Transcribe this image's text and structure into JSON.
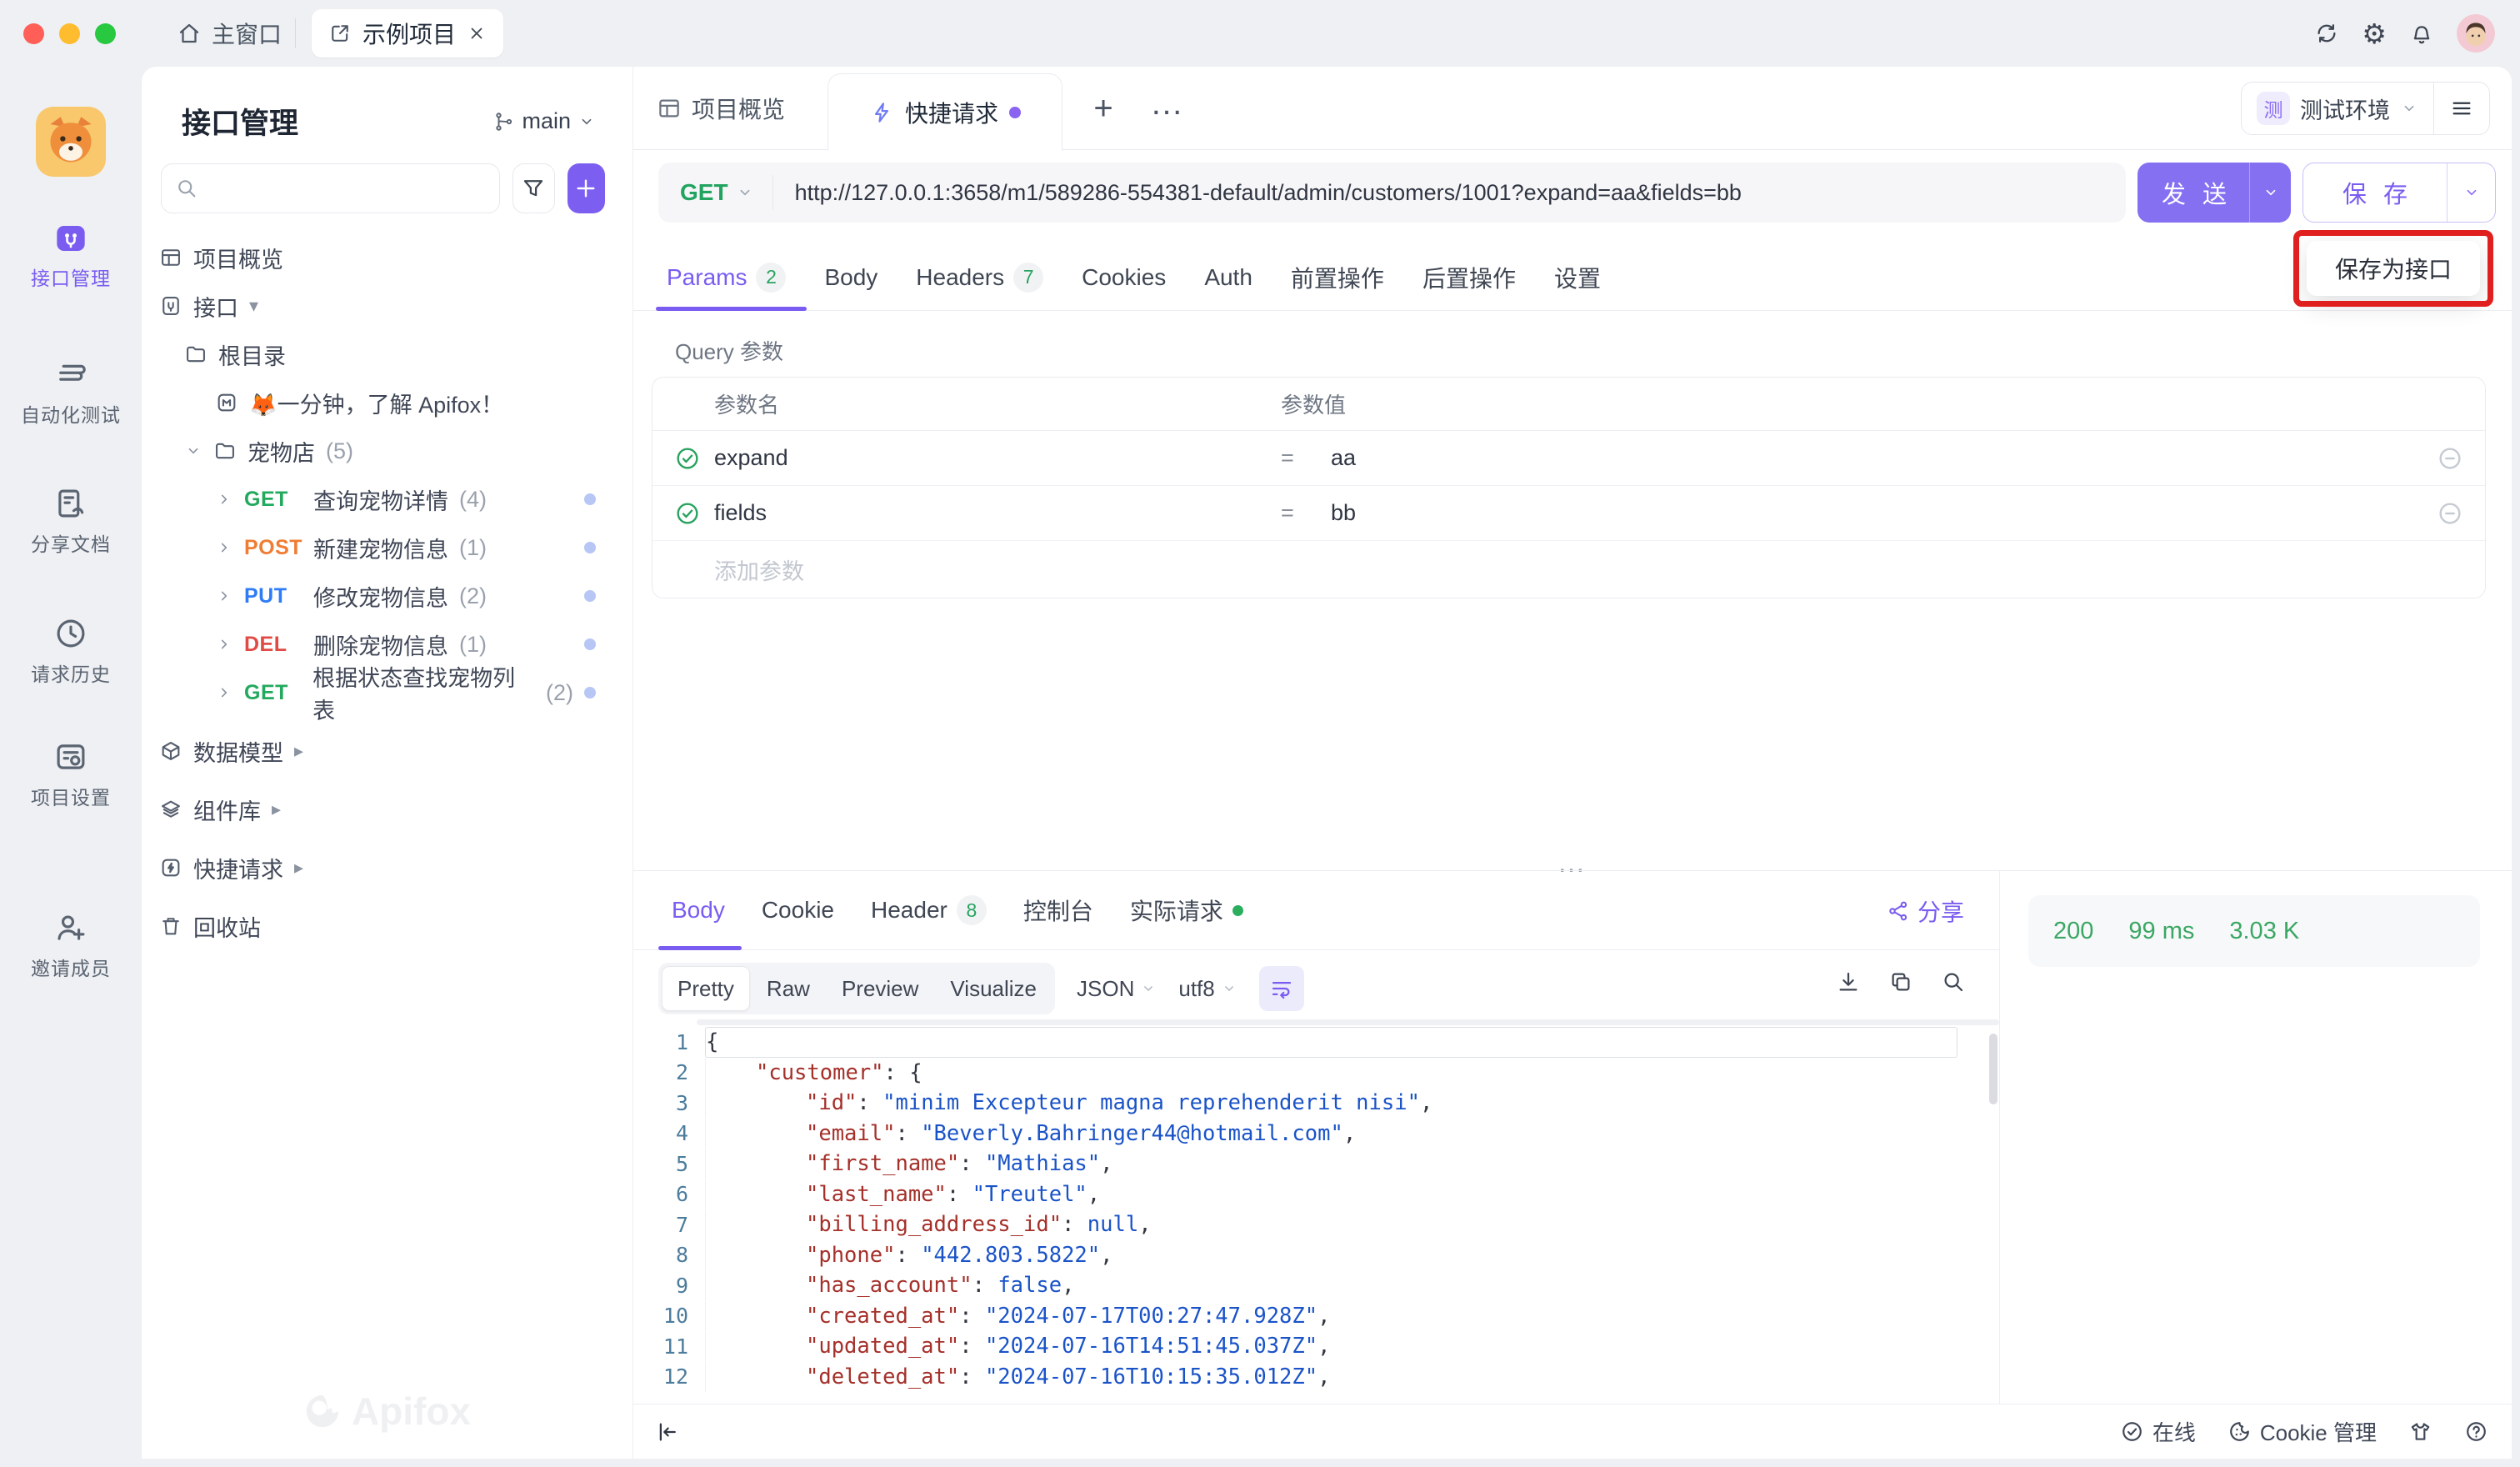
{
  "icons": {
    "gear": "⚙",
    "plus": "+",
    "ellipsis": "…",
    "more_tabs": "…",
    "caret_down": "▾",
    "caret_right": "▸"
  },
  "titlebar": {
    "home_tab": "主窗口",
    "project_tab": "示例项目"
  },
  "rail": {
    "items": [
      {
        "label": "接口管理"
      },
      {
        "label": "自动化测试"
      },
      {
        "label": "分享文档"
      },
      {
        "label": "请求历史"
      },
      {
        "label": "项目设置"
      },
      {
        "label": "邀请成员"
      }
    ]
  },
  "sidebar": {
    "title": "接口管理",
    "branch": "main",
    "tree": {
      "overview": "项目概览",
      "api_root": "接口",
      "root_folder": "根目录",
      "doc": "🦊一分钟，了解 Apifox！",
      "petstore": "宠物店",
      "petstore_count": "(5)",
      "items": [
        {
          "method": "GET",
          "label": "查询宠物详情",
          "count": "(4)"
        },
        {
          "method": "POST",
          "label": "新建宠物信息",
          "count": "(1)"
        },
        {
          "method": "PUT",
          "label": "修改宠物信息",
          "count": "(2)"
        },
        {
          "method": "DEL",
          "label": "删除宠物信息",
          "count": "(1)"
        },
        {
          "method": "GET",
          "label": "根据状态查找宠物列表",
          "count": "(2)"
        }
      ],
      "models": "数据模型",
      "components": "组件库",
      "quick": "快捷请求",
      "trash": "回收站"
    },
    "watermark": "Apifox"
  },
  "tabs": {
    "overview": "项目概览",
    "quick": "快捷请求"
  },
  "env": {
    "badge": "测",
    "label": "测试环境"
  },
  "request": {
    "method": "GET",
    "url": "http://127.0.0.1:3658/m1/589286-554381-default/admin/customers/1001?expand=aa&fields=bb",
    "send": "发 送",
    "save": "保 存",
    "save_menu": "保存为接口"
  },
  "subtabs": {
    "params": "Params",
    "params_badge": "2",
    "body": "Body",
    "headers": "Headers",
    "headers_badge": "7",
    "cookies": "Cookies",
    "auth": "Auth",
    "pre": "前置操作",
    "post": "后置操作",
    "settings": "设置"
  },
  "query": {
    "section": "Query 参数",
    "col_name": "参数名",
    "col_value": "参数值",
    "rows": [
      {
        "name": "expand",
        "eq": "=",
        "value": "aa"
      },
      {
        "name": "fields",
        "eq": "=",
        "value": "bb"
      }
    ],
    "add": "添加参数"
  },
  "response": {
    "tabs": {
      "body": "Body",
      "cookie": "Cookie",
      "header": "Header",
      "header_badge": "8",
      "console": "控制台",
      "actual": "实际请求"
    },
    "share": "分享",
    "viewer": {
      "pretty": "Pretty",
      "raw": "Raw",
      "preview": "Preview",
      "visualize": "Visualize",
      "lang": "JSON",
      "charset": "utf8"
    },
    "status": {
      "code": "200",
      "time": "99 ms",
      "size": "3.03 K"
    }
  },
  "code": {
    "lines": [
      {
        "n": "1",
        "tail": "{"
      },
      {
        "n": "2",
        "key": "\"customer\"",
        "sep": ": ",
        "tail": "{"
      },
      {
        "n": "3",
        "key": "\"id\"",
        "sep": ": ",
        "val": "\"minim Excepteur magna reprehenderit nisi\"",
        "tail": ","
      },
      {
        "n": "4",
        "key": "\"email\"",
        "sep": ": ",
        "val": "\"Beverly.Bahringer44@hotmail.com\"",
        "tail": ","
      },
      {
        "n": "5",
        "key": "\"first_name\"",
        "sep": ": ",
        "val": "\"Mathias\"",
        "tail": ","
      },
      {
        "n": "6",
        "key": "\"last_name\"",
        "sep": ": ",
        "val": "\"Treutel\"",
        "tail": ","
      },
      {
        "n": "7",
        "key": "\"billing_address_id\"",
        "sep": ": ",
        "val": "null",
        "tail": ","
      },
      {
        "n": "8",
        "key": "\"phone\"",
        "sep": ": ",
        "val": "\"442.803.5822\"",
        "tail": ","
      },
      {
        "n": "9",
        "key": "\"has_account\"",
        "sep": ": ",
        "val": "false",
        "tail": ","
      },
      {
        "n": "10",
        "key": "\"created_at\"",
        "sep": ": ",
        "val": "\"2024-07-17T00:27:47.928Z\"",
        "tail": ","
      },
      {
        "n": "11",
        "key": "\"updated_at\"",
        "sep": ": ",
        "val": "\"2024-07-16T14:51:45.037Z\"",
        "tail": ","
      },
      {
        "n": "12",
        "key": "\"deleted_at\"",
        "sep": ": ",
        "val": "\"2024-07-16T10:15:35.012Z\"",
        "tail": ","
      }
    ]
  },
  "statusbar": {
    "online": "在线",
    "cookie": "Cookie 管理"
  }
}
